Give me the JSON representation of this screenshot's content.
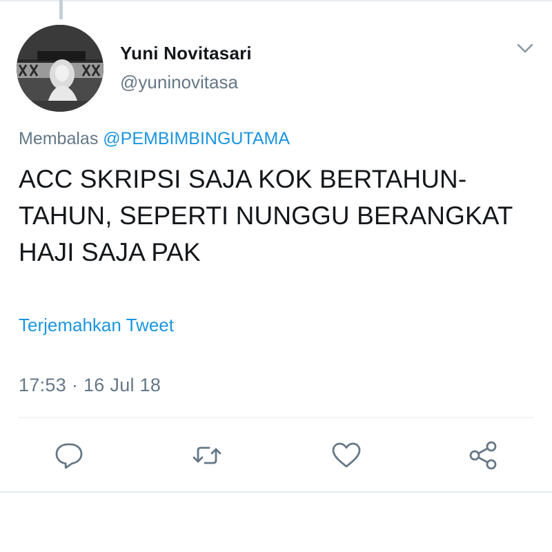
{
  "tweet": {
    "author": {
      "display_name": "Yuni Novitasari",
      "handle": "@yuninovitasa",
      "avatar_icon": "profile-photo"
    },
    "reply_prefix": "Membalas",
    "reply_mention": "@PEMBIMBINGUTAMA",
    "text": "ACC SKRIPSI SAJA KOK BERTAHUN-TAHUN, SEPERTI NUNGGU BERANGKAT HAJI SAJA PAK",
    "translate_label": "Terjemahkan Tweet",
    "timestamp": "17:53 · 16 Jul 18"
  },
  "actions": [
    {
      "name": "reply",
      "icon": "speech-bubble-icon"
    },
    {
      "name": "retweet",
      "icon": "retweet-icon"
    },
    {
      "name": "like",
      "icon": "heart-icon"
    },
    {
      "name": "share",
      "icon": "share-icon"
    }
  ],
  "colors": {
    "link": "#1b95e0",
    "secondary_text": "#657786",
    "primary_text": "#14171a",
    "divider": "#e6ecf0"
  }
}
